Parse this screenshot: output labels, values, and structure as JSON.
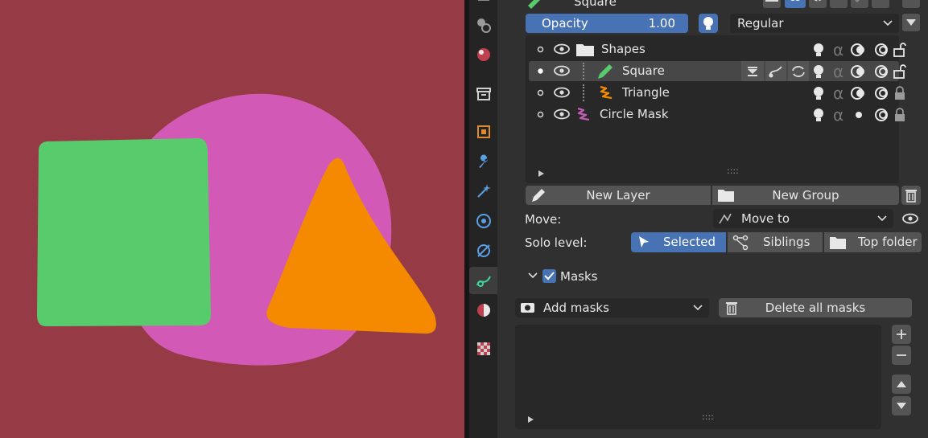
{
  "colors": {
    "viewport_bg": "#963b45",
    "circle": "#d25ab6",
    "square": "#58cc6c",
    "triangle": "#f58a00",
    "accent": "#4772b3",
    "panel_bg": "#303030"
  },
  "header": {
    "active_layer_name": "Square"
  },
  "opacity": {
    "label": "Opacity",
    "value": "1.00",
    "fill_fraction": 1.0
  },
  "blend_mode": {
    "selected": "Regular"
  },
  "layers": [
    {
      "name": "Shapes",
      "kind": "group",
      "icon": "folder-icon"
    },
    {
      "name": "Square",
      "kind": "layer",
      "icon": "pencil-icon",
      "selected": true
    },
    {
      "name": "Triangle",
      "kind": "layer",
      "icon": "stroke-icon"
    },
    {
      "name": "Circle Mask",
      "kind": "layer",
      "icon": "stroke-icon"
    }
  ],
  "buttons": {
    "new_layer": "New Layer",
    "new_group": "New Group"
  },
  "move": {
    "label": "Move:",
    "value": "Move to"
  },
  "solo": {
    "label": "Solo level:",
    "options": [
      "Selected",
      "Siblings",
      "Top folder"
    ],
    "selected": "Selected"
  },
  "masks": {
    "label": "Masks",
    "enabled": true,
    "add_label": "Add masks",
    "delete_all_label": "Delete all masks"
  },
  "list_grip": "::::"
}
